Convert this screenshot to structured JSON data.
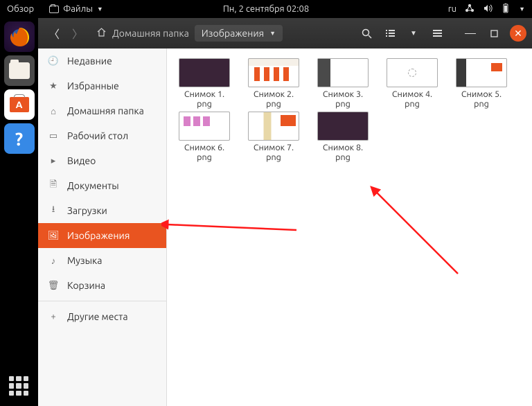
{
  "topbar": {
    "activities": "Обзор",
    "app_menu": "Файлы",
    "clock": "Пн, 2 сентября  02:08",
    "lang": "ru"
  },
  "launcher": {
    "firefox": "firefox",
    "files": "files",
    "software": "ubuntu-software",
    "help": "help"
  },
  "header": {
    "home": "Домашняя папка",
    "current": "Изображения"
  },
  "sidebar": {
    "items": [
      {
        "icon": "🕘",
        "label": "Недавние"
      },
      {
        "icon": "★",
        "label": "Избранные"
      },
      {
        "icon": "⌂",
        "label": "Домашняя папка"
      },
      {
        "icon": "▭",
        "label": "Рабочий стол"
      },
      {
        "icon": "▸",
        "label": "Видео"
      },
      {
        "icon": "🗎",
        "label": "Документы"
      },
      {
        "icon": "⭳",
        "label": "Загрузки"
      },
      {
        "icon": "🖼",
        "label": "Изображения"
      },
      {
        "icon": "♪",
        "label": "Музыка"
      },
      {
        "icon": "🗑",
        "label": "Корзина"
      },
      {
        "icon": "+",
        "label": "Другие места"
      }
    ]
  },
  "files": [
    {
      "name": "Снимок 1.\npng"
    },
    {
      "name": "Снимок 2.\npng"
    },
    {
      "name": "Снимок 3.\npng"
    },
    {
      "name": "Снимок 4.\npng"
    },
    {
      "name": "Снимок 5.\npng"
    },
    {
      "name": "Снимок 6.\npng"
    },
    {
      "name": "Снимок 7.\npng"
    },
    {
      "name": "Снимок 8.\npng"
    }
  ]
}
